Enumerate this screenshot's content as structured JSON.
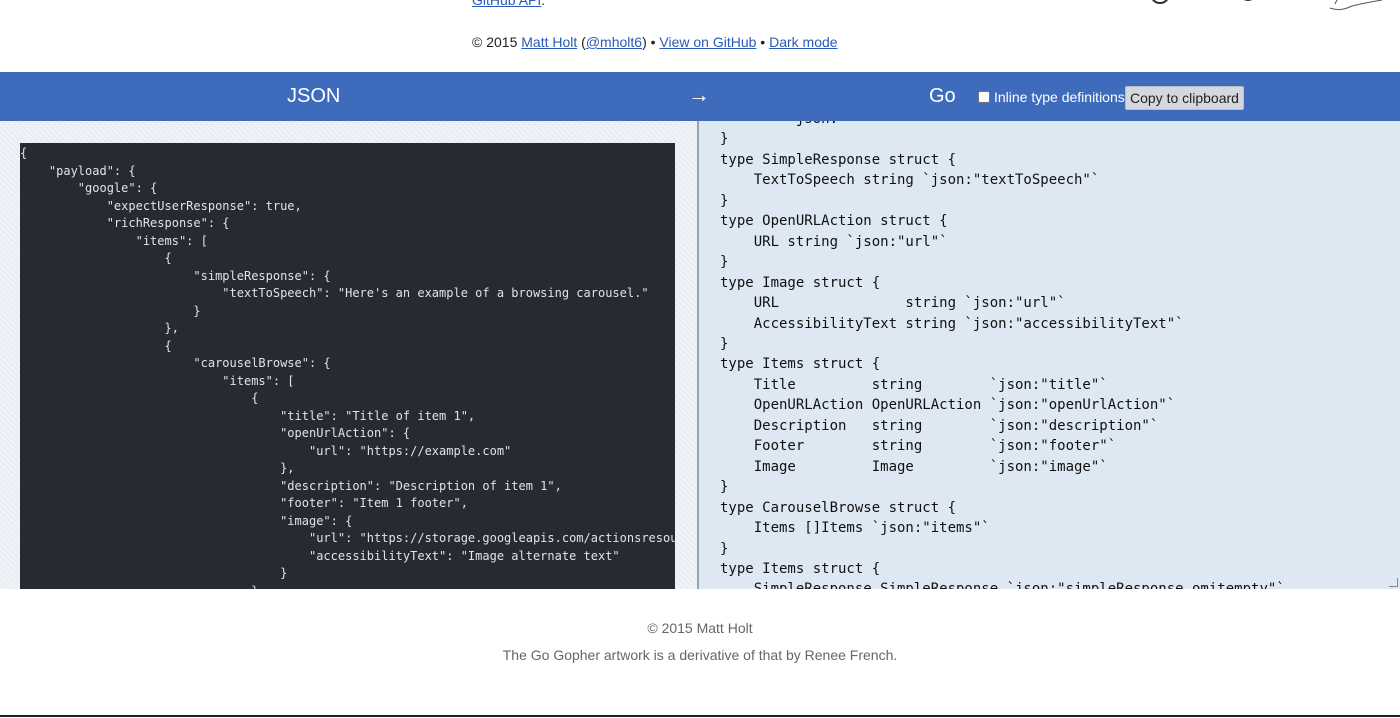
{
  "header": {
    "github_api_link": "GitHub API",
    "github_api_suffix": ".",
    "copyright_prefix": "© 2015 ",
    "author_link": "Matt Holt",
    "handle_open": " (",
    "handle_link": "@mholt6",
    "handle_close": ") • ",
    "view_github_link": "View on GitHub",
    "sep": " • ",
    "dark_mode_link": "Dark mode"
  },
  "toolbar": {
    "json_label": "JSON",
    "arrow": "→",
    "go_label": "Go",
    "inline_checkbox_label": "Inline type definitions",
    "inline_checked": false,
    "copy_button": "Copy to clipboard",
    "bar_color": "#3f6bbd"
  },
  "json_input": "{\n    \"payload\": {\n        \"google\": {\n            \"expectUserResponse\": true,\n            \"richResponse\": {\n                \"items\": [\n                    {\n                        \"simpleResponse\": {\n                            \"textToSpeech\": \"Here's an example of a browsing carousel.\"\n                        }\n                    },\n                    {\n                        \"carouselBrowse\": {\n                            \"items\": [\n                                {\n                                    \"title\": \"Title of item 1\",\n                                    \"openUrlAction\": {\n                                        \"url\": \"https://example.com\"\n                                    },\n                                    \"description\": \"Description of item 1\",\n                                    \"footer\": \"Item 1 footer\",\n                                    \"image\": {\n                                        \"url\": \"https://storage.googleapis.com/actionsresources/\n                                        \"accessibilityText\": \"Image alternate text\"\n                                    }\n                                }",
  "go_output": "        `json:\"\"`\n}\ntype SimpleResponse struct {\n    TextToSpeech string `json:\"textToSpeech\"`\n}\ntype OpenURLAction struct {\n    URL string `json:\"url\"`\n}\ntype Image struct {\n    URL               string `json:\"url\"`\n    AccessibilityText string `json:\"accessibilityText\"`\n}\ntype Items struct {\n    Title         string        `json:\"title\"`\n    OpenURLAction OpenURLAction `json:\"openUrlAction\"`\n    Description   string        `json:\"description\"`\n    Footer        string        `json:\"footer\"`\n    Image         Image         `json:\"image\"`\n}\ntype CarouselBrowse struct {\n    Items []Items `json:\"items\"`\n}\ntype Items struct {\n    SimpleResponse SimpleResponse `json:\"simpleResponse,omitempty\"`",
  "footer": {
    "copyright": "© 2015 Matt Holt",
    "artwork_note": "The Go Gopher artwork is a derivative of that by Renee French."
  }
}
